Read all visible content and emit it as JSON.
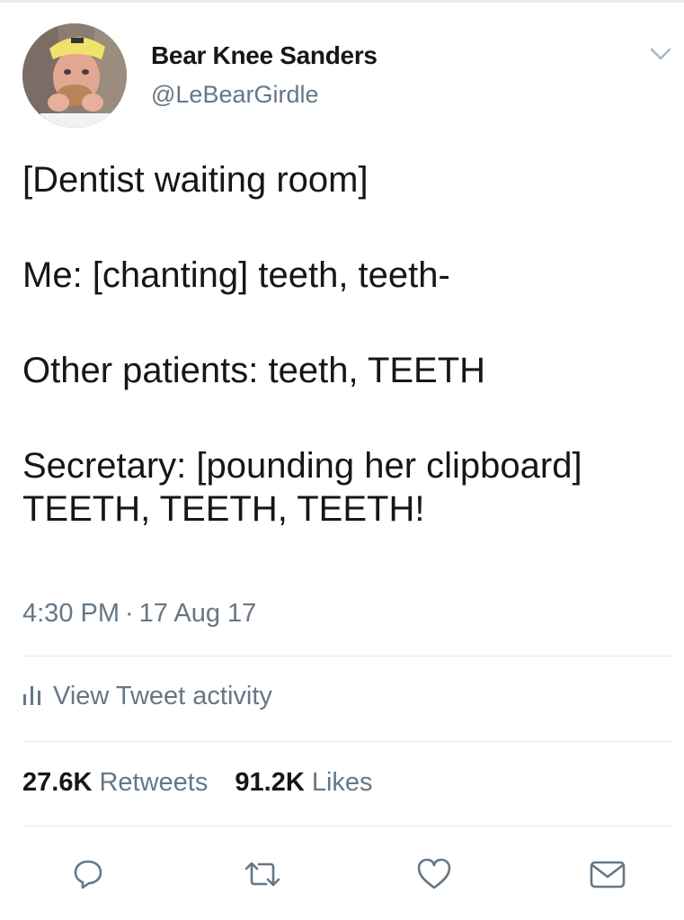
{
  "author": {
    "display_name": "Bear Knee Sanders",
    "handle": "@LeBearGirdle",
    "avatar_icon": "profile-photo"
  },
  "tweet": {
    "lines": [
      "[Dentist waiting room]",
      "Me: [chanting] teeth, teeth-",
      "Other patients: teeth, TEETH",
      "Secretary: [pounding her clipboard] TEETH, TEETH, TEETH!"
    ],
    "time": "4:30 PM",
    "date": "17 Aug 17",
    "separator": "·"
  },
  "activity": {
    "icon": "bar-chart-icon",
    "label": "View Tweet activity"
  },
  "stats": {
    "retweets_count": "27.6K",
    "retweets_label": "Retweets",
    "likes_count": "91.2K",
    "likes_label": "Likes"
  },
  "actions": [
    "reply-icon",
    "retweet-icon",
    "like-icon",
    "message-icon"
  ],
  "colors": {
    "text_primary": "#14171a",
    "text_secondary": "#657786",
    "divider": "#e1e8ed"
  }
}
